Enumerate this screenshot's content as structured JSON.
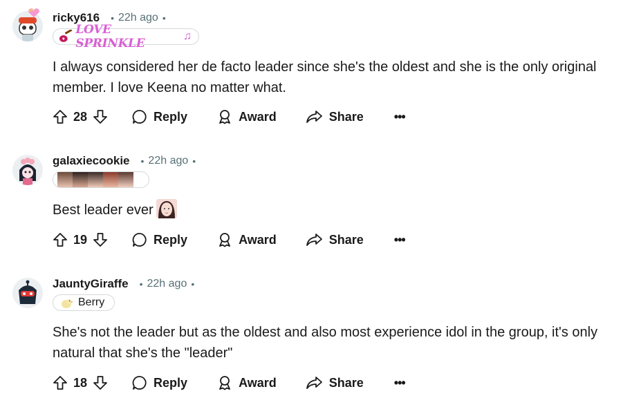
{
  "colors": {
    "text": "#1a1a1b",
    "meta": "#576f76",
    "border": "#d5dadc",
    "flair_love": "#d85fd3"
  },
  "comments": [
    {
      "username": "ricky616",
      "time": "22h ago",
      "flair": "LOVE SPRINKLE",
      "flair_type": "text-with-emoji",
      "body": "I always considered her de facto leader since she's the oldest and she is the only original member. I love Keena no matter what.",
      "votes": "28",
      "reply_label": "Reply",
      "award_label": "Award",
      "share_label": "Share"
    },
    {
      "username": "galaxiecookie",
      "time": "22h ago",
      "flair_type": "image-strip",
      "body": "Best leader ever",
      "votes": "19",
      "reply_label": "Reply",
      "award_label": "Award",
      "share_label": "Share"
    },
    {
      "username": "JauntyGiraffe",
      "time": "22h ago",
      "flair": "Berry",
      "flair_type": "text-with-emoji",
      "body": "She's not the leader but as the oldest and also most experience idol in the group, it's only natural that she's the \"leader\"",
      "votes": "18",
      "reply_label": "Reply",
      "award_label": "Award",
      "share_label": "Share"
    }
  ],
  "icons": [
    "upvote-icon",
    "downvote-icon",
    "reply-bubble-icon",
    "award-icon",
    "share-icon",
    "more-options-icon"
  ]
}
